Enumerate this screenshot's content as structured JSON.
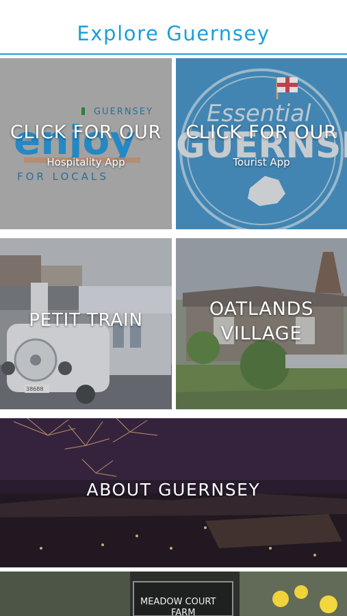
{
  "header": {
    "title": "Explore Guernsey"
  },
  "tiles": {
    "hospitality": {
      "heading": "CLICK FOR OUR",
      "subheading": "Hospitality App",
      "logo_top": "GUERNSEY",
      "logo_word": "enjoy",
      "logo_bottom": "FOR LOCALS"
    },
    "tourist": {
      "heading": "CLICK FOR OUR",
      "subheading": "Tourist App",
      "logo_script": "Essential",
      "logo_word": "GUERNSEY"
    },
    "petit_train": {
      "label": "PETIT TRAIN",
      "plate": "38688"
    },
    "oatlands": {
      "label_line1": "OATLANDS",
      "label_line2": "VILLAGE"
    },
    "about": {
      "label": "ABOUT GUERNSEY"
    },
    "meadow": {
      "sign_line1": "MEADOW COURT",
      "sign_line2": "FARM"
    }
  },
  "colors": {
    "accent": "#1a9fd8",
    "tile_overlay": "#9a9a9a",
    "tourist_blue": "#1f7fbf"
  }
}
